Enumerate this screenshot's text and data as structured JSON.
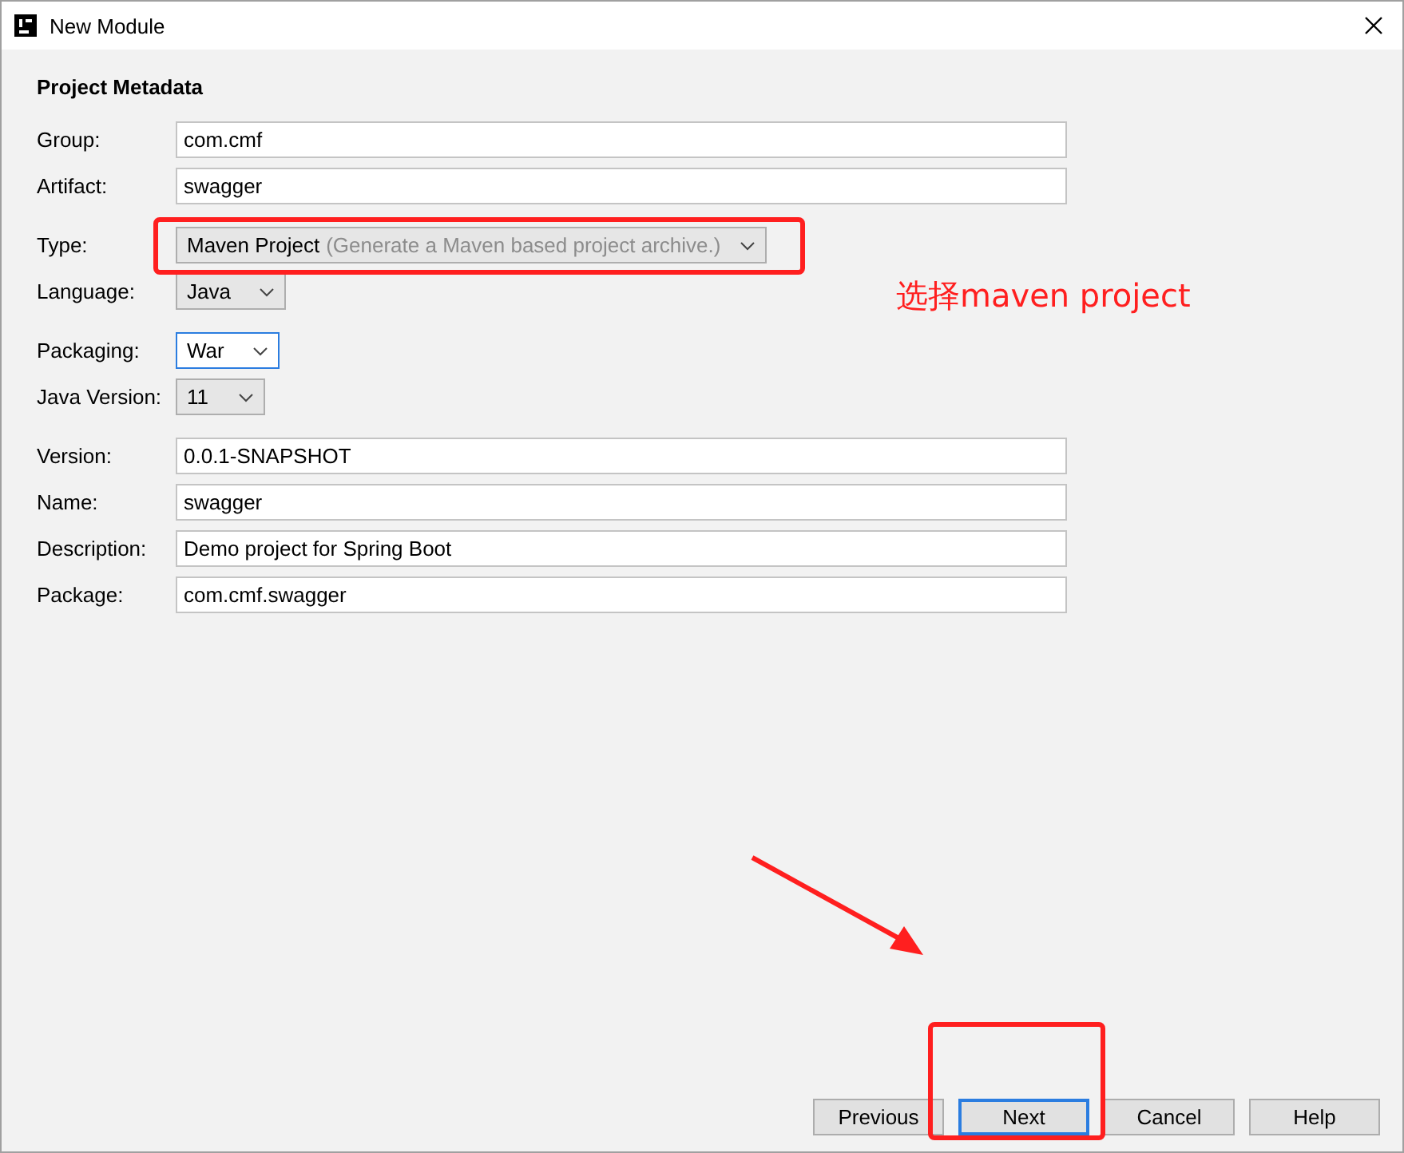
{
  "window": {
    "title": "New Module"
  },
  "section_title": "Project Metadata",
  "sections": [
    [
      {
        "label": "Group:",
        "kind": "text",
        "value": "com.cmf"
      },
      {
        "label": "Artifact:",
        "kind": "text",
        "value": "swagger"
      }
    ],
    [
      {
        "label": "Type:",
        "kind": "select",
        "value": "Maven Project",
        "hint": "(Generate a Maven based project archive.)",
        "focused": false
      },
      {
        "label": "Language:",
        "kind": "select",
        "value": "Java",
        "focused": false
      }
    ],
    [
      {
        "label": "Packaging:",
        "kind": "select",
        "value": "War",
        "focused": true
      },
      {
        "label": "Java Version:",
        "kind": "select",
        "value": "11",
        "focused": false
      }
    ],
    [
      {
        "label": "Version:",
        "kind": "text",
        "value": "0.0.1-SNAPSHOT"
      },
      {
        "label": "Name:",
        "kind": "text",
        "value": "swagger"
      },
      {
        "label": "Description:",
        "kind": "text",
        "value": "Demo project for Spring Boot"
      },
      {
        "label": "Package:",
        "kind": "text",
        "value": "com.cmf.swagger"
      }
    ]
  ],
  "buttons": [
    {
      "label": "Previous",
      "default": false
    },
    {
      "label": "Next",
      "default": true
    },
    {
      "label": "Cancel",
      "default": false
    },
    {
      "label": "Help",
      "default": false
    }
  ],
  "annotation": {
    "text": "选择maven project"
  }
}
